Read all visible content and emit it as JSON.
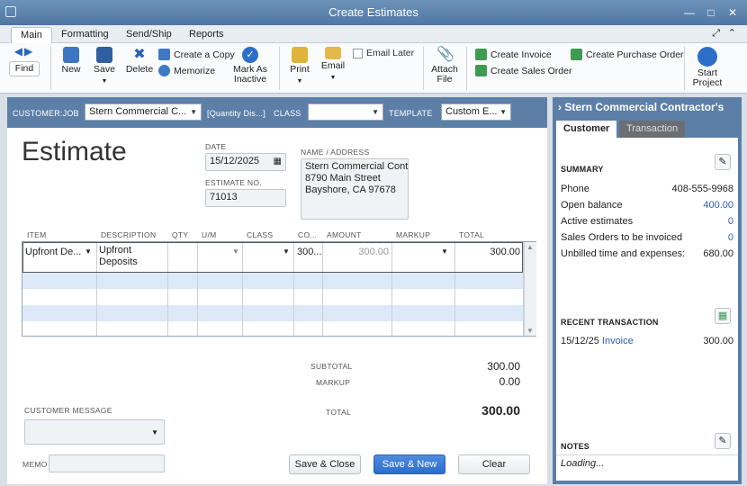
{
  "window": {
    "title": "Create Estimates"
  },
  "tabs": [
    "Main",
    "Formatting",
    "Send/Ship",
    "Reports"
  ],
  "toolbar": {
    "find": "Find",
    "new": "New",
    "save": "Save",
    "delete": "Delete",
    "create_copy": "Create a Copy",
    "memorize": "Memorize",
    "mark_inactive_line1": "Mark As",
    "mark_inactive_line2": "Inactive",
    "print": "Print",
    "email": "Email",
    "email_later": "Email Later",
    "attach_line1": "Attach",
    "attach_line2": "File",
    "create_invoice": "Create Invoice",
    "create_sales_order": "Create Sales Order",
    "create_purchase_order": "Create Purchase Order",
    "start_project_line1": "Start",
    "start_project_line2": "Project"
  },
  "customer_bar": {
    "customer_job_label": "CUSTOMER:JOB",
    "customer_job_value": "Stern Commercial C...",
    "quantity_note": "[Quantity Dis...]",
    "class_label": "CLASS",
    "class_value": "",
    "template_label": "TEMPLATE",
    "template_value": "Custom E..."
  },
  "form": {
    "title": "Estimate",
    "date_label": "DATE",
    "date_value": "15/12/2025",
    "estimate_no_label": "ESTIMATE NO.",
    "estimate_no_value": "71013",
    "name_address_label": "NAME / ADDRESS",
    "address_line1": "Stern Commercial Contr",
    "address_line2": "8790 Main Street",
    "address_line3": "Bayshore, CA 97678"
  },
  "grid": {
    "headers": [
      "ITEM",
      "DESCRIPTION",
      "QTY",
      "U/M",
      "CLASS",
      "CO...",
      "AMOUNT",
      "MARKUP",
      "TOTAL"
    ],
    "row": {
      "item": "Upfront De...",
      "description_line1": "Upfront",
      "description_line2": "Deposits",
      "cost": "300...",
      "amount": "300.00",
      "total": "300.00"
    }
  },
  "totals": {
    "subtotal_label": "SUBTOTAL",
    "subtotal_value": "300.00",
    "markup_label": "MARKUP",
    "markup_value": "0.00",
    "total_label": "TOTAL",
    "total_value": "300.00"
  },
  "footer": {
    "customer_message_label": "CUSTOMER MESSAGE",
    "memo_label": "MEMO",
    "save_close": "Save & Close",
    "save_new": "Save & New",
    "clear": "Clear"
  },
  "side_panel": {
    "title": "Stern Commercial Contractor's",
    "tab_customer": "Customer",
    "tab_transaction": "Transaction",
    "summary_title": "SUMMARY",
    "summary": [
      {
        "label": "Phone",
        "value": "408-555-9968"
      },
      {
        "label": "Open balance",
        "value": "400.00"
      },
      {
        "label": "Active estimates",
        "value": "0"
      },
      {
        "label": "Sales Orders to be invoiced",
        "value": "0"
      },
      {
        "label": "Unbilled time and expenses:",
        "value": "680.00"
      }
    ],
    "recent_title": "RECENT TRANSACTION",
    "recent_date": "15/12/25",
    "recent_type": "Invoice",
    "recent_amount": "300.00",
    "notes_title": "NOTES",
    "notes_status": "Loading..."
  }
}
